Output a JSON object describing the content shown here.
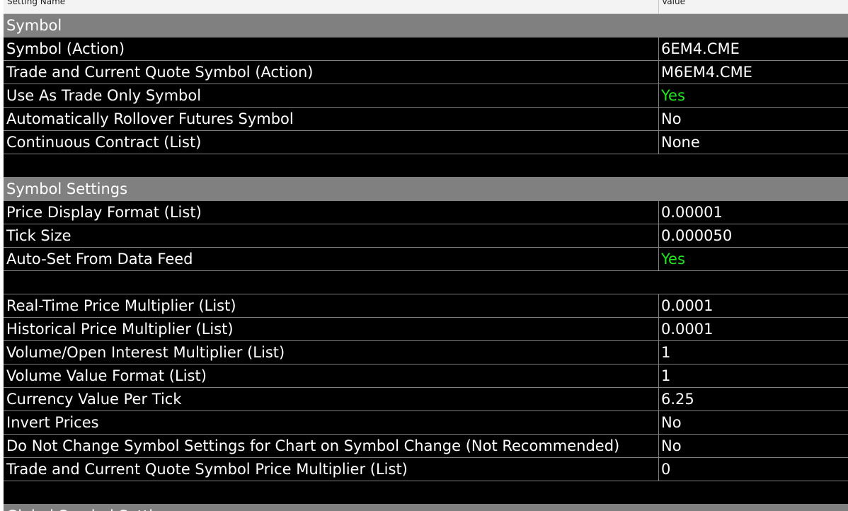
{
  "columns": {
    "name_header": "Setting Name",
    "value_header": "Value"
  },
  "colors": {
    "section_bg": "#808080",
    "row_bg": "#000000",
    "yes_text": "#22e622",
    "text": "#ffffff"
  },
  "rows": [
    {
      "kind": "section",
      "name": "Symbol"
    },
    {
      "kind": "setting",
      "name": "Symbol (Action)",
      "value": "6EM4.CME"
    },
    {
      "kind": "setting",
      "name": "Trade and Current Quote Symbol (Action)",
      "value": "M6EM4.CME"
    },
    {
      "kind": "setting",
      "name": "Use As Trade Only Symbol",
      "value": "Yes",
      "highlight": true
    },
    {
      "kind": "setting",
      "name": "Automatically Rollover Futures Symbol",
      "value": "No"
    },
    {
      "kind": "setting",
      "name": "Continuous Contract (List)",
      "value": "None"
    },
    {
      "kind": "blank"
    },
    {
      "kind": "section",
      "name": "Symbol Settings"
    },
    {
      "kind": "setting",
      "name": "Price Display Format (List)",
      "value": "0.00001"
    },
    {
      "kind": "setting",
      "name": "Tick Size",
      "value": "0.000050"
    },
    {
      "kind": "setting",
      "name": "Auto-Set From Data Feed",
      "value": "Yes",
      "highlight": true
    },
    {
      "kind": "blank"
    },
    {
      "kind": "setting",
      "name": "Real-Time Price Multiplier (List)",
      "value": "0.0001"
    },
    {
      "kind": "setting",
      "name": "Historical Price Multiplier (List)",
      "value": "0.0001"
    },
    {
      "kind": "setting",
      "name": "Volume/Open Interest Multiplier (List)",
      "value": "1"
    },
    {
      "kind": "setting",
      "name": "Volume Value Format (List)",
      "value": "1"
    },
    {
      "kind": "setting",
      "name": "Currency Value Per Tick",
      "value": "6.25"
    },
    {
      "kind": "setting",
      "name": "Invert Prices",
      "value": "No"
    },
    {
      "kind": "setting",
      "name": "Do Not Change Symbol Settings for Chart on Symbol Change (Not Recommended)",
      "value": "No"
    },
    {
      "kind": "setting",
      "name": "Trade and Current Quote Symbol Price Multiplier (List)",
      "value": "0"
    },
    {
      "kind": "blank"
    },
    {
      "kind": "section",
      "name": "Global Symbol Settings"
    }
  ]
}
